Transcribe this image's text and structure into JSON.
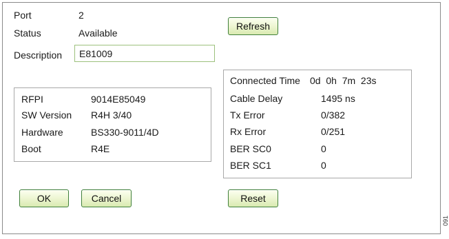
{
  "port": {
    "label": "Port",
    "value": "2"
  },
  "status": {
    "label": "Status",
    "value": "Available"
  },
  "description": {
    "label": "Description",
    "value": "E81009"
  },
  "buttons": {
    "refresh": "Refresh",
    "ok": "OK",
    "cancel": "Cancel",
    "reset": "Reset"
  },
  "device_info": [
    {
      "label": "RFPI",
      "value": "9014E85049"
    },
    {
      "label": "SW Version",
      "value": "R4H 3/40"
    },
    {
      "label": "Hardware",
      "value": "BS330-9011/4D"
    },
    {
      "label": "Boot",
      "value": "R4E"
    }
  ],
  "link_stats": {
    "connected_time": {
      "label": "Connected Time",
      "value": "0d  0h  7m  23s"
    },
    "rows": [
      {
        "label": "Cable Delay",
        "value": "1495 ns"
      },
      {
        "label": "Tx Error",
        "value": "0/382"
      },
      {
        "label": "Rx Error",
        "value": "0/251"
      },
      {
        "label": "BER SC0",
        "value": "0"
      },
      {
        "label": "BER SC1",
        "value": "0"
      }
    ]
  },
  "figure_id": "091",
  "colors": {
    "button_border": "#3f7f3a",
    "button_fill_top": "#fcfff0",
    "button_fill_bottom": "#d9eab0",
    "input_border": "#9cc07c",
    "box_border": "#a8a8a8",
    "panel_border": "#8a8a8a"
  }
}
